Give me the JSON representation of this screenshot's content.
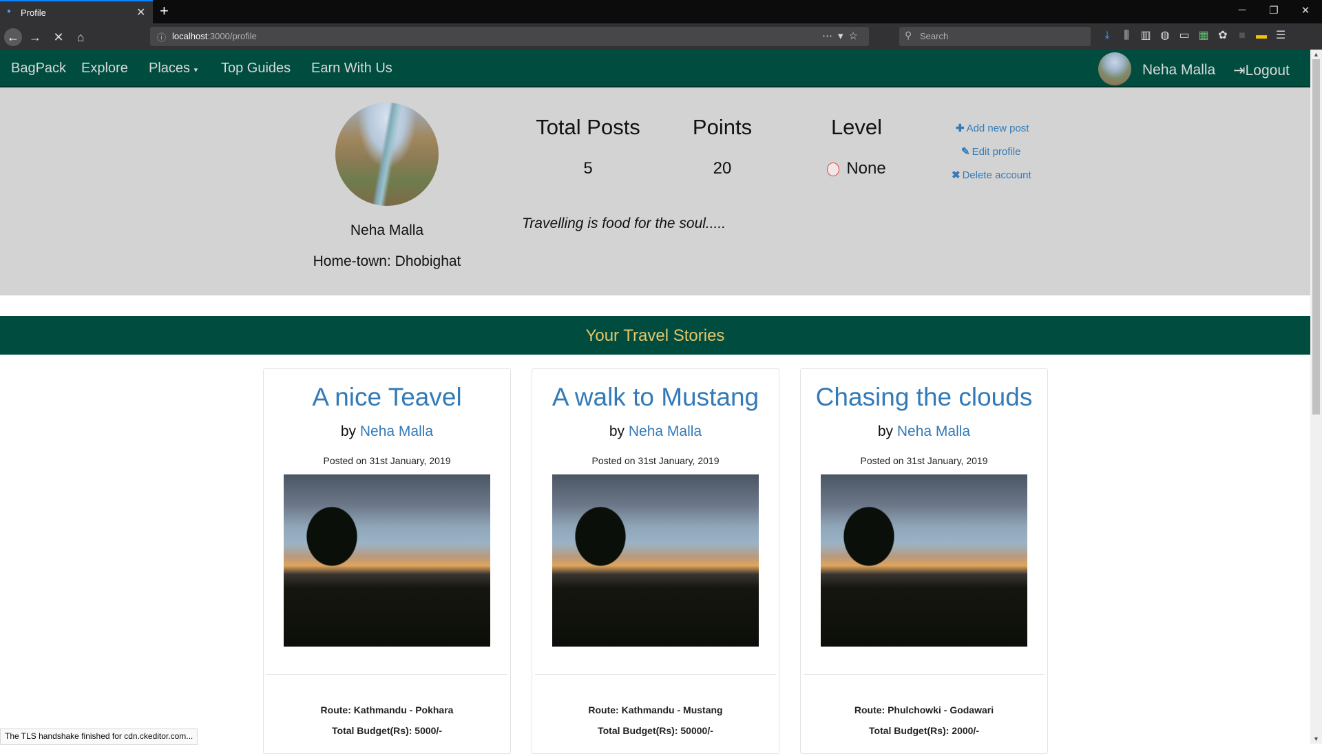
{
  "browser": {
    "tab_title": "Profile",
    "tab_close": "✕",
    "new_tab": "+",
    "url_host": "localhost",
    "url_path": ":3000/profile",
    "search_placeholder": "Search",
    "icons": [
      "download-icon",
      "library-icon",
      "sidebar-icon",
      "extension-icon",
      "extension-icon",
      "extension-icon",
      "extension-icon",
      "extension-icon",
      "extension-icon",
      "menu-icon"
    ],
    "status_text": "The TLS handshake finished for cdn.ckeditor.com..."
  },
  "nav": {
    "brand": "BagPack",
    "explore": "Explore",
    "places": "Places",
    "top_guides": "Top Guides",
    "earn": "Earn With Us",
    "user": "Neha Malla",
    "logout": "Logout"
  },
  "profile": {
    "name": "Neha Malla",
    "hometown": "Home-town: Dhobighat",
    "motto": "Travelling is food for the soul.....",
    "stats": {
      "posts_label": "Total Posts",
      "posts_value": "5",
      "points_label": "Points",
      "points_value": "20",
      "level_label": "Level",
      "level_value": "None"
    },
    "actions": {
      "add": "Add new post",
      "edit": "Edit profile",
      "delete": "Delete account"
    }
  },
  "stories": {
    "heading": "Your Travel Stories",
    "by_prefix": "by",
    "cards": [
      {
        "title": "A nice Teavel",
        "author": "Neha Malla",
        "date": "Posted on 31st January, 2019",
        "route": "Route: Kathmandu - Pokhara",
        "budget": "Total Budget(Rs): 5000/-"
      },
      {
        "title": "A walk to Mustang",
        "author": "Neha Malla",
        "date": "Posted on 31st January, 2019",
        "route": "Route: Kathmandu - Mustang",
        "budget": "Total Budget(Rs): 50000/-"
      },
      {
        "title": "Chasing the clouds",
        "author": "Neha Malla",
        "date": "Posted on 31st January, 2019",
        "route": "Route: Phulchowki - Godawari",
        "budget": "Total Budget(Rs): 2000/-"
      }
    ]
  },
  "colors": {
    "nav_bg": "#004d40",
    "band_title": "#e3c66b",
    "link": "#337ab7",
    "header_bg": "#d3d3d3"
  }
}
